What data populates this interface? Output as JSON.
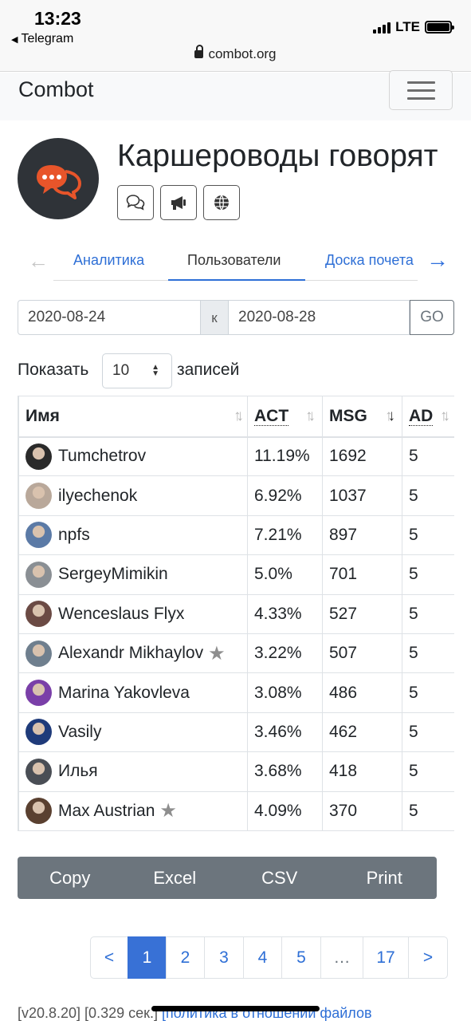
{
  "status": {
    "time": "13:23",
    "back_app": "Telegram",
    "network": "LTE",
    "url": "combot.org"
  },
  "navbar": {
    "brand": "Combot"
  },
  "group": {
    "title": "Каршероводы говорят",
    "icons": [
      "chats-icon",
      "megaphone-icon",
      "globe-icon"
    ]
  },
  "tabs": [
    {
      "label": "Аналитика",
      "active": false
    },
    {
      "label": "Пользователи",
      "active": true
    },
    {
      "label": "Доска почета",
      "active": false
    }
  ],
  "daterange": {
    "from": "2020-08-24",
    "separator": "к",
    "to": "2020-08-28",
    "go": "GO"
  },
  "show": {
    "label": "Показать",
    "value": "10",
    "records": "записей"
  },
  "table": {
    "headers": [
      "Имя",
      "ACT",
      "MSG",
      "AD"
    ],
    "rows": [
      {
        "name": "Tumchetrov",
        "act": "11.19%",
        "msg": "1692",
        "ad": "5",
        "star": false,
        "color": "#2a2a2a"
      },
      {
        "name": "ilyechenok",
        "act": "6.92%",
        "msg": "1037",
        "ad": "5",
        "star": false,
        "color": "#b9a89a"
      },
      {
        "name": "npfs",
        "act": "7.21%",
        "msg": "897",
        "ad": "5",
        "star": false,
        "color": "#5b7aa6"
      },
      {
        "name": "SergeyMimikin",
        "act": "5.0%",
        "msg": "701",
        "ad": "5",
        "star": false,
        "color": "#8a8f94"
      },
      {
        "name": "Wenceslaus Flyx",
        "act": "4.33%",
        "msg": "527",
        "ad": "5",
        "star": false,
        "color": "#6b4a44"
      },
      {
        "name": "Alexandr Mikhaylov",
        "act": "3.22%",
        "msg": "507",
        "ad": "5",
        "star": true,
        "color": "#6f7f8e"
      },
      {
        "name": "Marina Yakovleva",
        "act": "3.08%",
        "msg": "486",
        "ad": "5",
        "star": false,
        "color": "#7a3fa8"
      },
      {
        "name": "Vasily",
        "act": "3.46%",
        "msg": "462",
        "ad": "5",
        "star": false,
        "color": "#1f3b7a"
      },
      {
        "name": "Илья",
        "act": "3.68%",
        "msg": "418",
        "ad": "5",
        "star": false,
        "color": "#4a4e55"
      },
      {
        "name": "Max Austrian",
        "act": "4.09%",
        "msg": "370",
        "ad": "5",
        "star": true,
        "color": "#5a4030"
      }
    ]
  },
  "buttons": [
    "Copy",
    "Excel",
    "CSV",
    "Print"
  ],
  "pagination": [
    "<",
    "1",
    "2",
    "3",
    "4",
    "5",
    "…",
    "17",
    ">"
  ],
  "pagination_active": "1",
  "footer": {
    "version": "[v20.8.20] [0.329 сек.]",
    "link": "[политика в отношении файлов"
  },
  "colors": {
    "accent": "#2e6fd6",
    "button_gray": "#6c757d",
    "avatar_bg": "#2f3338",
    "logo_orange": "#e8552a"
  }
}
